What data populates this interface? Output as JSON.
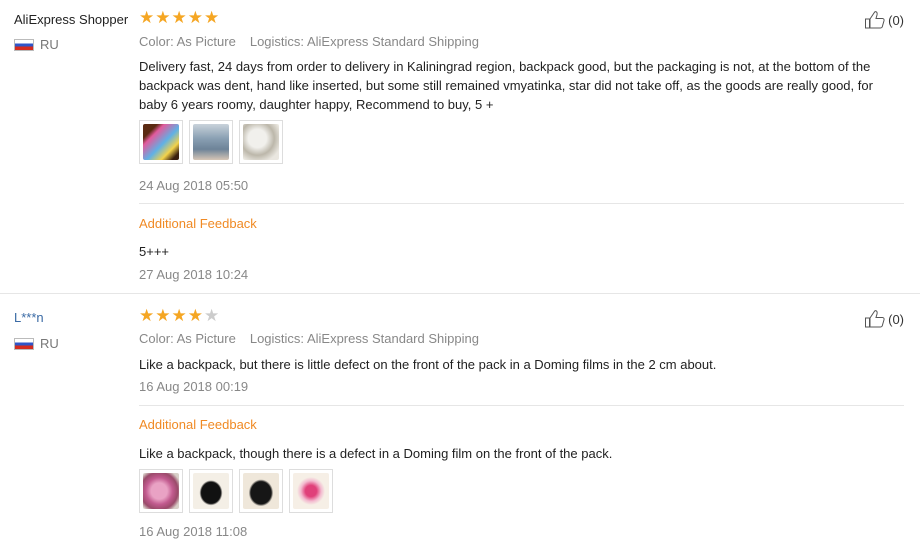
{
  "reviews": [
    {
      "user": "AliExpress Shopper",
      "country": "RU",
      "rating": 5,
      "helpful": "(0)",
      "color_label": "Color:",
      "color_value": "As Picture",
      "logistics_label": "Logistics:",
      "logistics_value": "AliExpress Standard Shipping",
      "text": "Delivery fast, 24 days from order to delivery in Kaliningrad region, backpack good, but the packaging is not, at the bottom of the backpack was dent, hand like inserted, but some still remained vmyatinka, star did not take off, as the goods are really good, for baby 6 years roomy, daughter happy, Recommend to buy, 5 +",
      "photos": 3,
      "date": "24 Aug 2018 05:50",
      "additional_title": "Additional Feedback",
      "additional_text": "5+++",
      "additional_date": "27 Aug 2018 10:24"
    },
    {
      "user": "L***n",
      "country": "RU",
      "rating": 4,
      "helpful": "(0)",
      "color_label": "Color:",
      "color_value": "As Picture",
      "logistics_label": "Logistics:",
      "logistics_value": "AliExpress Standard Shipping",
      "text": "Like a backpack, but there is little defect on the front of the pack in a Doming films in the 2 cm about.",
      "date": "16 Aug 2018 00:19",
      "additional_title": "Additional Feedback",
      "additional_text": "Like a backpack, though there is a defect in a Doming film on the front of the pack.",
      "additional_photos": 4,
      "additional_date": "16 Aug 2018 11:08"
    }
  ],
  "colors": {
    "star_on": "#f5a623",
    "star_off": "#cccccc",
    "accent_orange": "#f08a24",
    "link_blue": "#3a6aa5"
  },
  "icons": {
    "helpful": "thumbs-up-icon",
    "flag": "russia-flag-icon",
    "star": "star-icon"
  }
}
